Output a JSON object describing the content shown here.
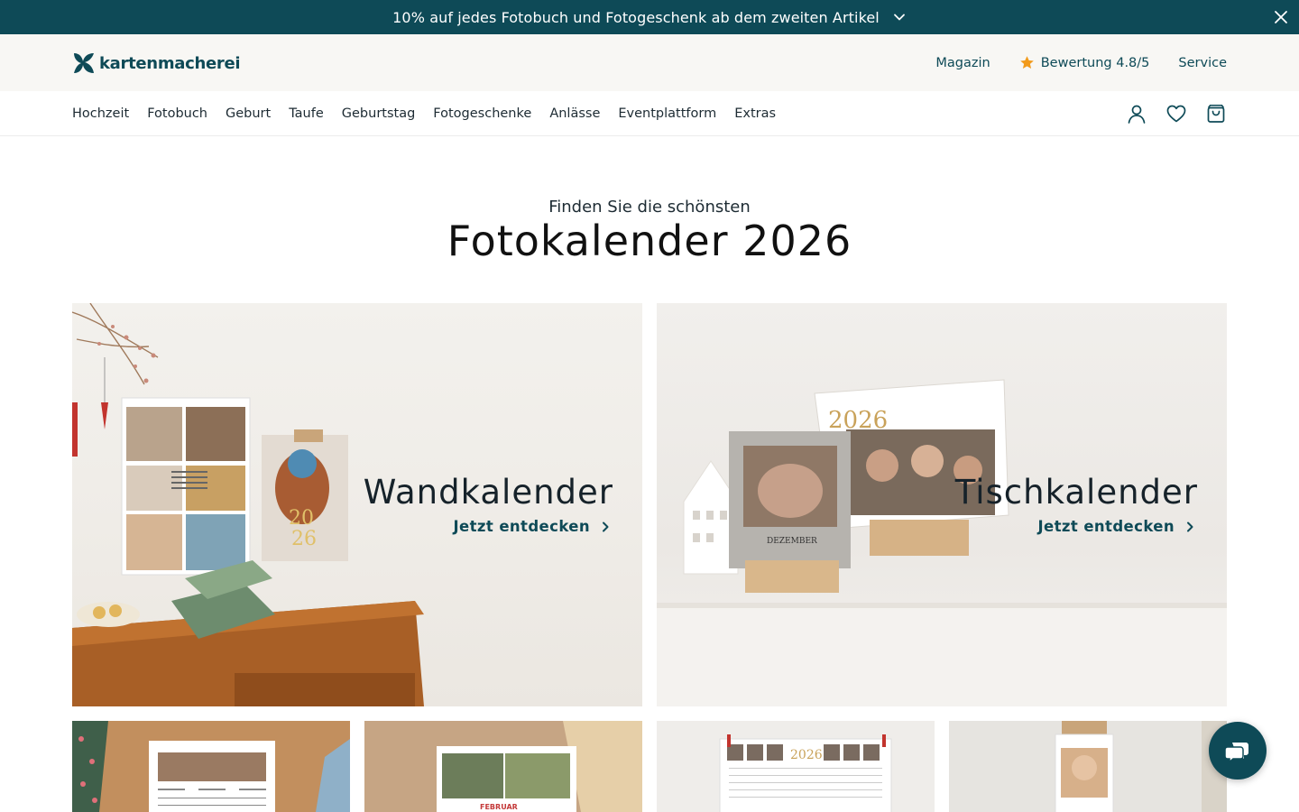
{
  "promo": {
    "text": "10% auf jedes Fotobuch und Fotogeschenk ab dem zweiten Artikel",
    "icons": [
      "chevron-down-icon",
      "close-icon"
    ]
  },
  "header": {
    "logo_text": "kartenmacherei",
    "links": {
      "magazin": "Magazin",
      "rating": "Bewertung 4.8/5",
      "service": "Service"
    },
    "rating_icon": "star-icon"
  },
  "nav": {
    "items": [
      "Hochzeit",
      "Fotobuch",
      "Geburt",
      "Taufe",
      "Geburtstag",
      "Fotogeschenke",
      "Anlässe",
      "Eventplattform",
      "Extras"
    ],
    "icons": [
      "user-icon",
      "heart-icon",
      "shopping-bag-icon"
    ]
  },
  "hero": {
    "eyebrow": "Finden Sie die schönsten",
    "title": "Fotokalender 2026"
  },
  "cards": [
    {
      "title": "Wandkalender",
      "cta": "Jetzt entdecken"
    },
    {
      "title": "Tischkalender",
      "cta": "Jetzt entdecken"
    }
  ],
  "thumbnails": [
    "wall-calendar-photo-1",
    "wall-calendar-photo-2",
    "year-planner-photo",
    "desk-calendar-photo"
  ],
  "colors": {
    "brand": "#0e4a57",
    "topbar_bg": "#f8f7f4",
    "text": "#1d2b33"
  },
  "chat_icon": "chat-bubble-icon"
}
